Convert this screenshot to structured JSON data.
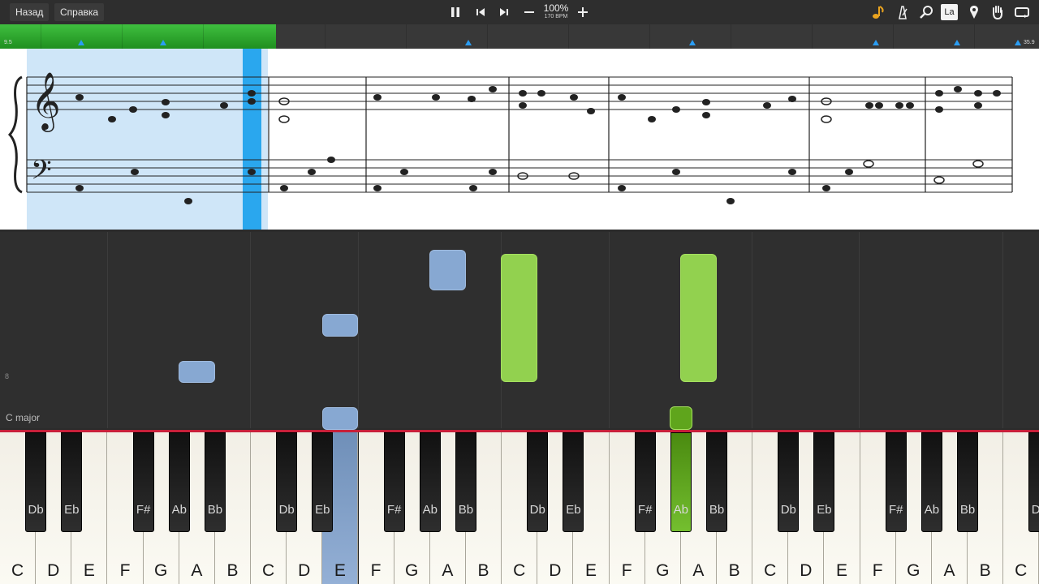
{
  "topbar": {
    "back_label": "Назад",
    "help_label": "Справка",
    "zoom": "100%",
    "bpm": "170 BPM",
    "la_label": "La"
  },
  "timeline": {
    "progress_fraction": 0.266,
    "start_label": "9.5",
    "end_label": "35.9"
  },
  "notes_panel": {
    "key_label": "C major",
    "octave_label": "8"
  },
  "keyboard": {
    "white_keys": [
      "C",
      "D",
      "E",
      "F",
      "G",
      "A",
      "B",
      "C",
      "D",
      "E",
      "F",
      "G",
      "A",
      "B",
      "C",
      "D",
      "E",
      "F",
      "G",
      "A",
      "B",
      "C",
      "D",
      "E",
      "F",
      "G",
      "A",
      "B",
      "C"
    ],
    "black_keys": [
      "Db",
      "Eb",
      "F#",
      "Ab",
      "Bb",
      "Db",
      "Eb",
      "F#",
      "Ab",
      "Bb",
      "Db",
      "Eb",
      "F#",
      "Ab",
      "Bb",
      "Db",
      "Eb",
      "F#",
      "Ab",
      "Bb",
      "Db"
    ]
  },
  "colors": {
    "left_hand": "#87a8d2",
    "right_hand": "#92d14f",
    "progress": "#2ea82e",
    "playhead": "#2aa7ee"
  }
}
